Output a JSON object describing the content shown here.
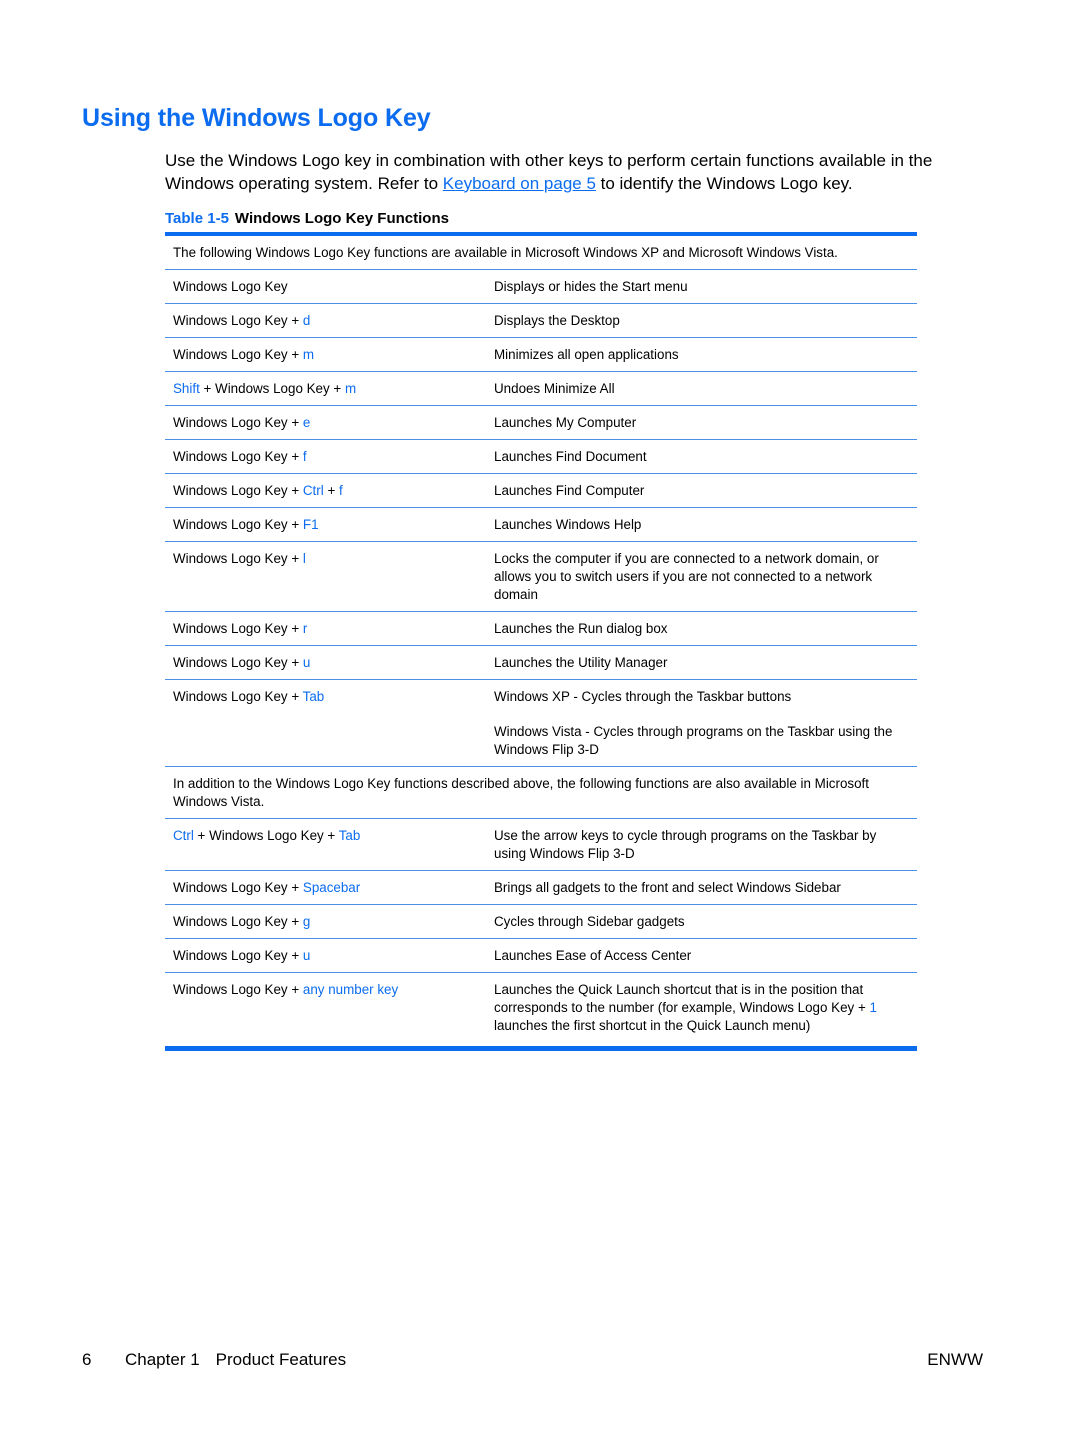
{
  "heading": "Using the Windows Logo Key",
  "intro": {
    "before": "Use the Windows Logo key in combination with other keys to perform certain functions available in the Windows operating system. Refer to ",
    "link": "Keyboard on page 5",
    "after": " to identify the Windows Logo key."
  },
  "caption": {
    "number": "Table 1-5",
    "title": "Windows Logo Key Functions"
  },
  "table": {
    "note_xp_vista": "The following Windows Logo Key functions are available in Microsoft Windows XP and Microsoft Windows Vista.",
    "rows_a": [
      {
        "key": [
          {
            "t": "Windows Logo Key",
            "b": false
          }
        ],
        "desc": [
          "Displays or hides the Start menu"
        ]
      },
      {
        "key": [
          {
            "t": "Windows Logo Key + ",
            "b": false
          },
          {
            "t": "d",
            "b": true
          }
        ],
        "desc": [
          "Displays the Desktop"
        ]
      },
      {
        "key": [
          {
            "t": "Windows Logo Key + ",
            "b": false
          },
          {
            "t": "m",
            "b": true
          }
        ],
        "desc": [
          "Minimizes all open applications"
        ]
      },
      {
        "key": [
          {
            "t": "Shift",
            "b": true
          },
          {
            "t": " + Windows Logo Key + ",
            "b": false
          },
          {
            "t": "m",
            "b": true
          }
        ],
        "desc": [
          "Undoes Minimize All"
        ]
      },
      {
        "key": [
          {
            "t": "Windows Logo Key + ",
            "b": false
          },
          {
            "t": "e",
            "b": true
          }
        ],
        "desc": [
          "Launches My Computer"
        ]
      },
      {
        "key": [
          {
            "t": "Windows Logo Key + ",
            "b": false
          },
          {
            "t": "f",
            "b": true
          }
        ],
        "desc": [
          "Launches Find Document"
        ]
      },
      {
        "key": [
          {
            "t": "Windows Logo Key + ",
            "b": false
          },
          {
            "t": "Ctrl",
            "b": true
          },
          {
            "t": " + ",
            "b": false
          },
          {
            "t": "f",
            "b": true
          }
        ],
        "desc": [
          "Launches Find Computer"
        ]
      },
      {
        "key": [
          {
            "t": "Windows Logo Key + ",
            "b": false
          },
          {
            "t": "F1",
            "b": true
          }
        ],
        "desc": [
          "Launches Windows Help"
        ]
      },
      {
        "key": [
          {
            "t": "Windows Logo Key + ",
            "b": false
          },
          {
            "t": "l",
            "b": true
          }
        ],
        "desc": [
          "Locks the computer if you are connected to a network domain, or allows you to switch users if you are not connected to a network domain"
        ]
      },
      {
        "key": [
          {
            "t": "Windows Logo Key + ",
            "b": false
          },
          {
            "t": "r",
            "b": true
          }
        ],
        "desc": [
          "Launches the Run dialog box"
        ]
      },
      {
        "key": [
          {
            "t": "Windows Logo Key + ",
            "b": false
          },
          {
            "t": "u",
            "b": true
          }
        ],
        "desc": [
          "Launches the Utility Manager"
        ]
      },
      {
        "key": [
          {
            "t": "Windows Logo Key + ",
            "b": false
          },
          {
            "t": "Tab",
            "b": true
          }
        ],
        "desc": [
          "Windows XP - Cycles through the Taskbar buttons",
          "Windows Vista - Cycles through programs on the Taskbar using the Windows Flip 3-D"
        ]
      }
    ],
    "note_vista": "In addition to the Windows Logo Key functions described above, the following functions are also available in Microsoft Windows Vista.",
    "rows_b": [
      {
        "key": [
          {
            "t": "Ctrl",
            "b": true
          },
          {
            "t": " + Windows Logo Key + ",
            "b": false
          },
          {
            "t": "Tab",
            "b": true
          }
        ],
        "desc": [
          "Use the arrow keys to cycle through programs on the Taskbar by using Windows Flip 3-D"
        ]
      },
      {
        "key": [
          {
            "t": "Windows Logo Key + ",
            "b": false
          },
          {
            "t": "Spacebar",
            "b": true
          }
        ],
        "desc": [
          "Brings all gadgets to the front and select Windows Sidebar"
        ]
      },
      {
        "key": [
          {
            "t": "Windows Logo Key + ",
            "b": false
          },
          {
            "t": "g",
            "b": true
          }
        ],
        "desc": [
          "Cycles through Sidebar gadgets"
        ]
      },
      {
        "key": [
          {
            "t": "Windows Logo Key + ",
            "b": false
          },
          {
            "t": "u",
            "b": true
          }
        ],
        "desc": [
          "Launches Ease of Access Center"
        ]
      },
      {
        "key": [
          {
            "t": "Windows Logo Key + ",
            "b": false
          },
          {
            "t": "any number key",
            "b": true
          }
        ],
        "desc_rich": [
          {
            "t": "Launches the Quick Launch shortcut that is in the position that corresponds to the number (for example, Windows Logo Key + ",
            "b": false
          },
          {
            "t": "1",
            "b": true
          },
          {
            "t": " launches the first shortcut in the Quick Launch menu)",
            "b": false
          }
        ]
      }
    ]
  },
  "footer": {
    "page": "6",
    "chapter": "Chapter 1",
    "section": "Product Features",
    "right": "ENWW"
  },
  "colors": {
    "accent": "#0b6cf0",
    "rule": "#4a90e8"
  }
}
